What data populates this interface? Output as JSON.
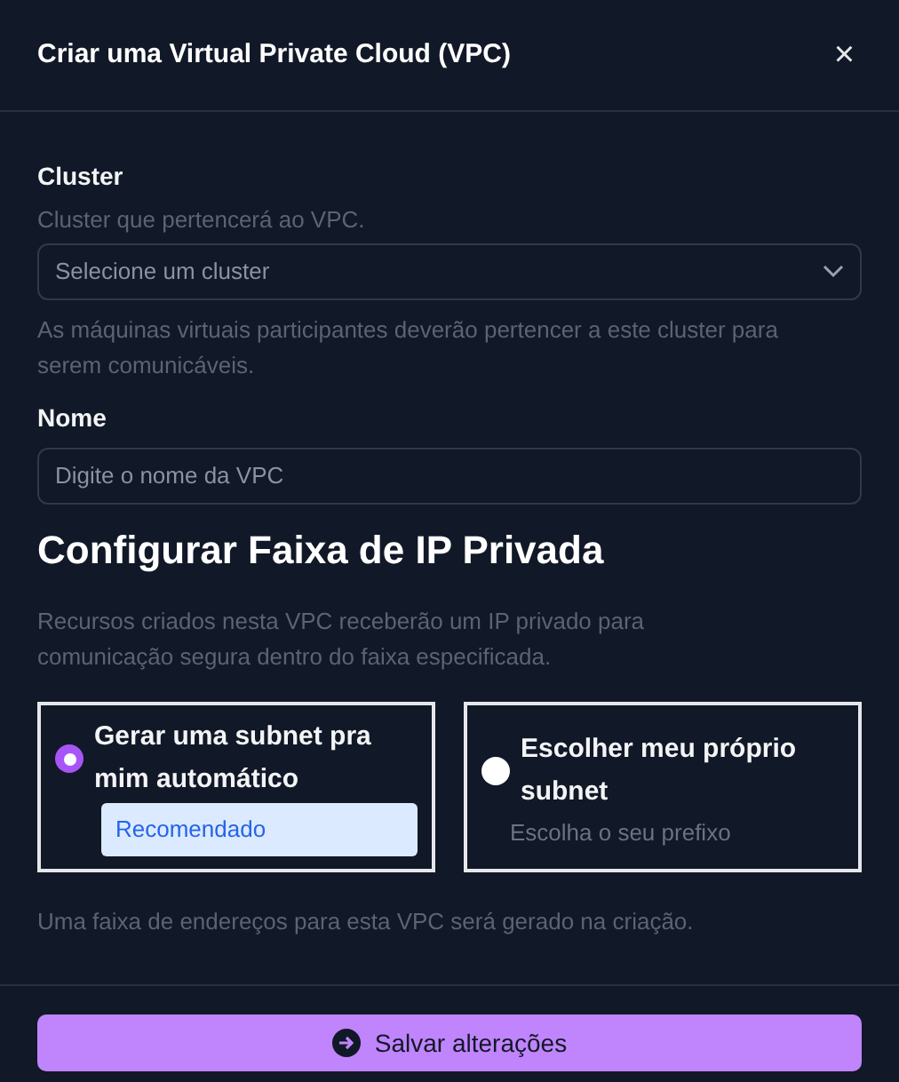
{
  "dialog": {
    "title": "Criar uma Virtual Private Cloud (VPC)",
    "close": "×"
  },
  "cluster": {
    "label": "Cluster",
    "description": "Cluster que pertencerá ao VPC.",
    "placeholder": "Selecione um cluster",
    "hint": "As máquinas virtuais participantes deverão pertencer a este cluster para serem comunicáveis."
  },
  "name": {
    "label": "Nome",
    "placeholder": "Digite o nome da VPC"
  },
  "ip_range": {
    "heading": "Configurar Faixa de IP Privada",
    "description": "Recursos criados nesta VPC receberão um IP privado para comunicação segura dentro do faixa especificada.",
    "options": [
      {
        "label": "Gerar uma subnet pra mim automático",
        "selected": true,
        "badge": "Recomendado"
      },
      {
        "label": "Escolher meu próprio subnet",
        "selected": false,
        "subtext": "Escolha o seu prefixo"
      }
    ],
    "note": "Uma faixa de endereços para esta VPC será gerado na criação."
  },
  "save_button": "Salvar alterações"
}
